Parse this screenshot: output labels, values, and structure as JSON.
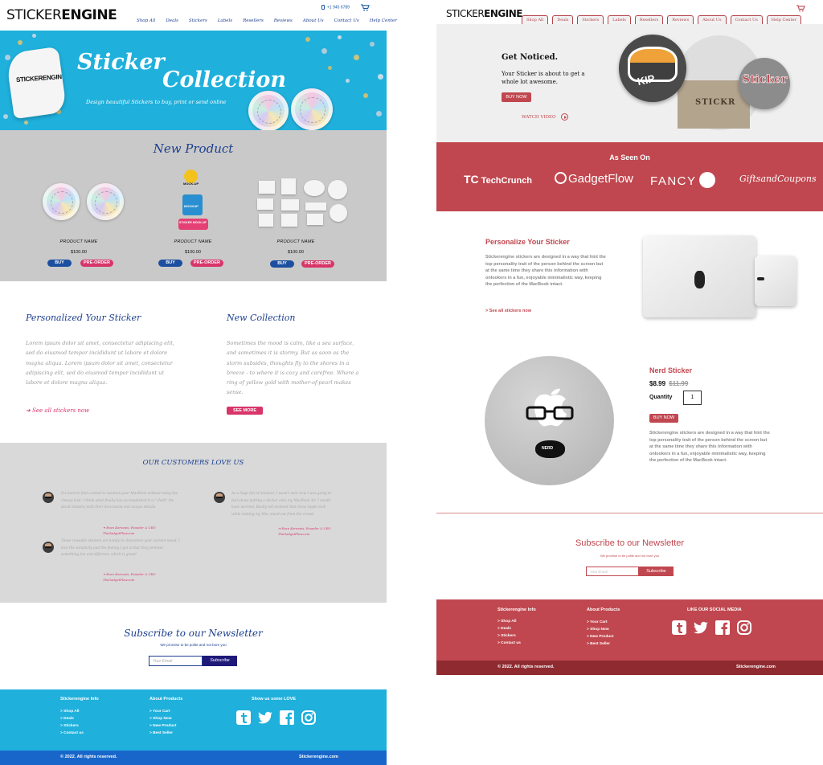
{
  "left": {
    "logo": {
      "thin": "STICKER",
      "bold": "ENGINE"
    },
    "phone": "+1 945 6789",
    "nav": [
      "Shop All",
      "Deals",
      "Stickers",
      "Labels",
      "Resellers",
      "Reviews",
      "About Us",
      "Contact Us",
      "Help Center"
    ],
    "hero": {
      "sticker_label": "STICKERENGIN",
      "title_line1": "Sticker",
      "title_line2": "Collection",
      "subtitle": "Design beautiful Stickers to buy, print or send online"
    },
    "new_product": {
      "title": "New Product",
      "products": [
        {
          "name": "PRODUCT NAME",
          "price": "$100.00",
          "buy": "BUY",
          "preorder": "PRE-ORDER"
        },
        {
          "name": "PRODUCT NAME",
          "price": "$100.00",
          "buy": "BUY",
          "preorder": "PRE-ORDER"
        },
        {
          "name": "PRODUCT NAME",
          "price": "$100.00",
          "buy": "BUY",
          "preorder": "PRE-ORDER"
        }
      ],
      "mockup_labels": [
        "MOCK-UP",
        "MOCKUP",
        "STICKER MOCK-UP"
      ]
    },
    "personalized": {
      "heading": "Personalized Your Sticker",
      "body": "Lorem ipsum dolor sit amet, consectetur adipiscing elit, sed do eiusmod tempor incididunt ut labore et dolore magna aliqua. Lorem ipsum dolor sit amet, consectetur adipiscing elit, sed do eiusmod tempor incididunt ut labore et dolore magna aliqua.",
      "link": "See all stickers now"
    },
    "collection": {
      "heading": "New Collection",
      "body": "Sometimes the mood is calm, like a sea surface, and sometimes it is stormy. But as soon as the storm subsides, thoughts fly to the shores in a breeze - to where it is cozy and carefree. Where a ring of yellow gold with mother-of-pearl makes sense.",
      "button": "SEE MORE"
    },
    "testimonials": {
      "title": "OUR CUSTOMERS LOVE US",
      "items": [
        {
          "quote": "It's hard to find a detail to mention your MacBook without today the cheesy look. I think what finally has accomplished it is \"chalk\" the decal industry with their decoration and unique details.",
          "by": "Evan Kornanis, Founder & CEO",
          "site": "TheGadgetFlow.com"
        },
        {
          "quote": "As a huge fan of minimal, I wasn't sure how I was going to feel about putting a sticker onto my MacBook Air. I would have worried, Really tell moment that these Apple look while making my Mac stand out from the crowd.",
          "by": "Evan Kornanis, Founder & CEO",
          "site": "TheGadgetFlow.com"
        },
        {
          "quote": "These reusable stickers are handy in characters your current mood. I love the simplicity and the feeling I got is that they promise something fun and different, which is great!",
          "by": "Evan Kornanis, Founder & CEO",
          "site": "TheGadgetFlow.com"
        }
      ]
    },
    "subscribe": {
      "heading": "Subscribe to our Newsletter",
      "sub": "We promise to be polite and not bore you",
      "placeholder": "Your Email",
      "button": "Subscribe"
    },
    "footer": {
      "col1_title": "Stickerengine Info",
      "col1": [
        "> Shop All",
        "> Deals",
        "> Stickers",
        "> Contact us"
      ],
      "col2_title": "About Products",
      "col2": [
        "> Your Cart",
        "> Shop Now",
        "> New Product",
        "> Best Seller"
      ],
      "col3_title": "Show us some LOVE",
      "copyright": "© 2022. All rights reserved.",
      "site": "Stickerengine.com"
    }
  },
  "right": {
    "logo": {
      "thin": "STICKER",
      "bold": "ENGINE"
    },
    "nav": [
      "Shop All",
      "Deals",
      "Stickers",
      "Labels",
      "Resellers",
      "Reviews",
      "About Us",
      "Contact Us",
      "Help Center"
    ],
    "hero": {
      "heading": "Get Noticed.",
      "body": "Your Sticker is about to get a whole lot awesome.",
      "button": "BUY NOW",
      "watch": "WATCH VIDEO",
      "mockup_label_a": "KIP",
      "mockup_label_b": "STICKR",
      "mockup_label_c": "Sticker"
    },
    "seen": {
      "title": "As Seen On",
      "brands": [
        "TechCrunch",
        "GadgetFlow",
        "FANCY",
        "GiftsandCoupons"
      ]
    },
    "personalize": {
      "heading": "Personalize Your Sticker",
      "body": "Stickerengine stickers are designed in a way that hint the top personality trait of the person behind the screen but at the same time they share this information with onlookers in a fun, enjoyable minimalistic way, keeping the perfection of the MacBook intact.",
      "link": "> See all stickers now"
    },
    "nerd": {
      "heading": "Nerd Sticker",
      "price": "$8.99",
      "old_price": "$11.99",
      "qty_label": "Quantity",
      "qty": "1",
      "button": "BUY NOW",
      "badge": "NERD",
      "body": "Stickerengine stickers are designed in a way that hint the top personality trait of the person behind the screen but at the same time they share this information with onlookers in a fun, enjoyable minimalistic way, keeping the perfection of the MacBook intact."
    },
    "subscribe": {
      "heading": "Subscribe to our Newsletter",
      "sub": "We promise to be polite and not bore you",
      "placeholder": "Your Email",
      "button": "Subscribe"
    },
    "footer": {
      "col1_title": "Stickerengine Info",
      "col1": [
        "> Shop All",
        "> Deals",
        "> Stickers",
        "> Contact us"
      ],
      "col2_title": "About Products",
      "col2": [
        "> Your Cart",
        "> Shop Now",
        "> New Product",
        "> Best Seller"
      ],
      "col3_title": "LIKE OUR SOCIAL MEDIA",
      "copyright": "© 2022. All rights reserved.",
      "site": "Stickerengine.com"
    }
  },
  "colors": {
    "left_blue": "#1fb0dc",
    "left_navy": "#1c3f8f",
    "left_pink": "#d8356a",
    "right_red": "#c0474f",
    "right_dark": "#8f2a30"
  }
}
